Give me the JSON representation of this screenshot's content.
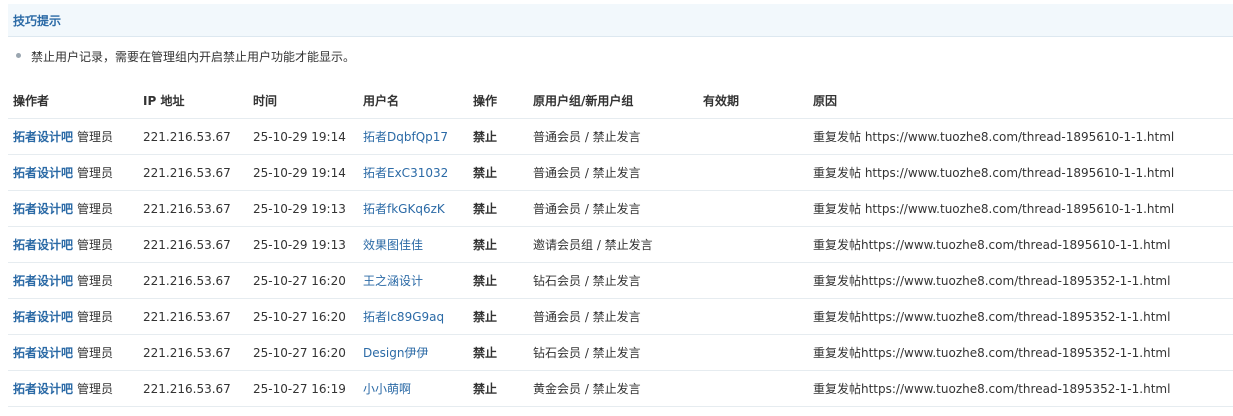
{
  "tips": {
    "title": "技巧提示",
    "text": "禁止用户记录，需要在管理组内开启禁止用户功能才能显示。"
  },
  "table": {
    "headers": {
      "operator": "操作者",
      "ip": "IP 地址",
      "time": "时间",
      "username": "用户名",
      "action": "操作",
      "group": "原用户组/新用户组",
      "expiry": "有效期",
      "reason": "原因"
    },
    "rows": [
      {
        "operator": "拓者设计吧",
        "role": "管理员",
        "ip": "221.216.53.67",
        "time": "25-10-29 19:14",
        "username": "拓者DqbfQp17",
        "action": "禁止",
        "group": "普通会员 / 禁止发言",
        "expiry": "",
        "reason": "重复发帖 https://www.tuozhe8.com/thread-1895610-1-1.html"
      },
      {
        "operator": "拓者设计吧",
        "role": "管理员",
        "ip": "221.216.53.67",
        "time": "25-10-29 19:14",
        "username": "拓者ExC31032",
        "action": "禁止",
        "group": "普通会员 / 禁止发言",
        "expiry": "",
        "reason": "重复发帖 https://www.tuozhe8.com/thread-1895610-1-1.html"
      },
      {
        "operator": "拓者设计吧",
        "role": "管理员",
        "ip": "221.216.53.67",
        "time": "25-10-29 19:13",
        "username": "拓者fkGKq6zK",
        "action": "禁止",
        "group": "普通会员 / 禁止发言",
        "expiry": "",
        "reason": "重复发帖 https://www.tuozhe8.com/thread-1895610-1-1.html"
      },
      {
        "operator": "拓者设计吧",
        "role": "管理员",
        "ip": "221.216.53.67",
        "time": "25-10-29 19:13",
        "username": "效果图佳佳",
        "action": "禁止",
        "group": "邀请会员组 / 禁止发言",
        "expiry": "",
        "reason": "重复发帖https://www.tuozhe8.com/thread-1895610-1-1.html"
      },
      {
        "operator": "拓者设计吧",
        "role": "管理员",
        "ip": "221.216.53.67",
        "time": "25-10-27 16:20",
        "username": "王之涵设计",
        "action": "禁止",
        "group": "钻石会员 / 禁止发言",
        "expiry": "",
        "reason": "重复发帖https://www.tuozhe8.com/thread-1895352-1-1.html"
      },
      {
        "operator": "拓者设计吧",
        "role": "管理员",
        "ip": "221.216.53.67",
        "time": "25-10-27 16:20",
        "username": "拓者lc89G9aq",
        "action": "禁止",
        "group": "普通会员 / 禁止发言",
        "expiry": "",
        "reason": "重复发帖https://www.tuozhe8.com/thread-1895352-1-1.html"
      },
      {
        "operator": "拓者设计吧",
        "role": "管理员",
        "ip": "221.216.53.67",
        "time": "25-10-27 16:20",
        "username": "Design伊伊",
        "action": "禁止",
        "group": "钻石会员 / 禁止发言",
        "expiry": "",
        "reason": "重复发帖https://www.tuozhe8.com/thread-1895352-1-1.html"
      },
      {
        "operator": "拓者设计吧",
        "role": "管理员",
        "ip": "221.216.53.67",
        "time": "25-10-27 16:19",
        "username": "小小萌啊",
        "action": "禁止",
        "group": "黄金会员 / 禁止发言",
        "expiry": "",
        "reason": "重复发帖https://www.tuozhe8.com/thread-1895352-1-1.html"
      }
    ]
  }
}
